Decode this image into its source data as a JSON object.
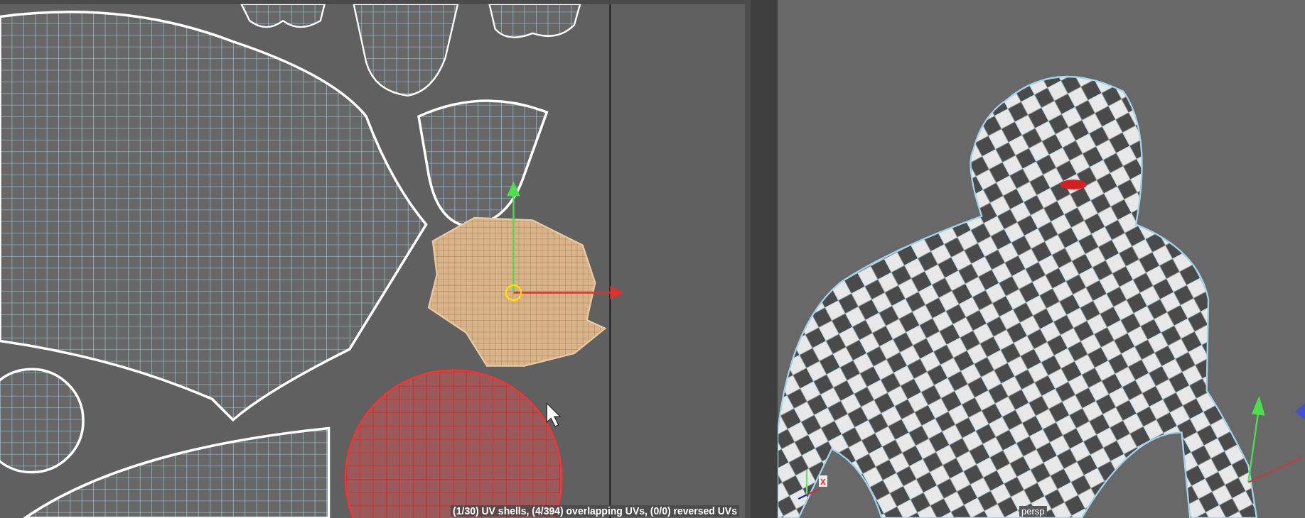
{
  "uv_editor": {
    "status": "(1/30) UV shells, (4/394) overlapping UVs, (0/0) reversed UVs"
  },
  "viewport": {
    "axis_label": "x",
    "camera_label": "persp"
  }
}
